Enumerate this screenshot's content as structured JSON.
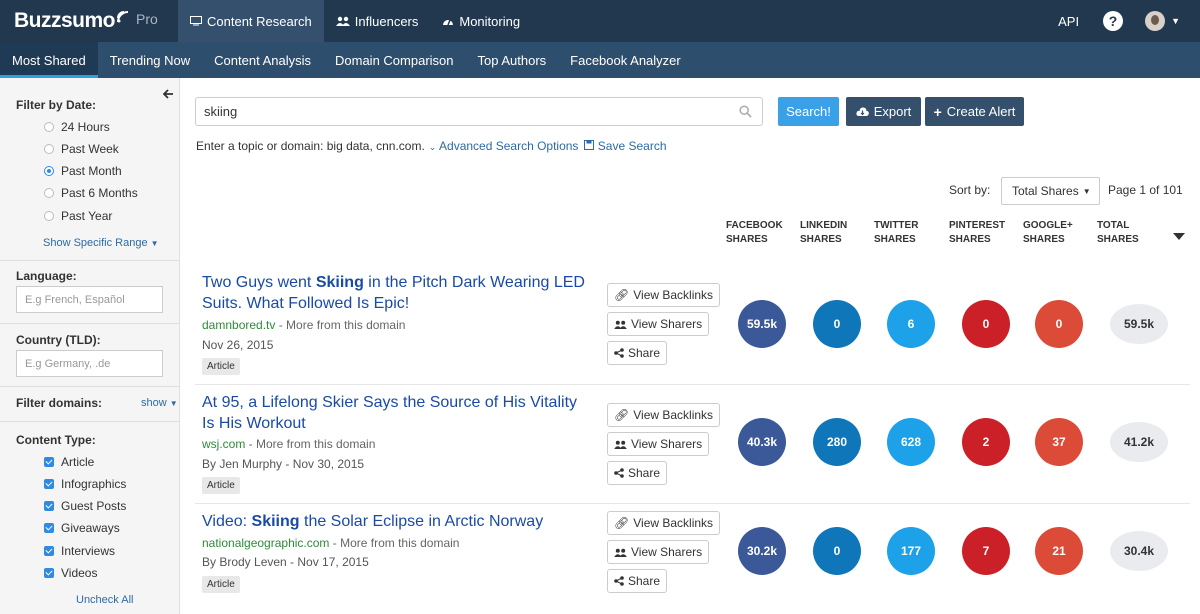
{
  "app": {
    "logo_text": "Buzzsumo",
    "logo_suffix": "Pro"
  },
  "topnav": [
    {
      "label": "Content Research",
      "icon": "monitor-icon",
      "active": true
    },
    {
      "label": "Influencers",
      "icon": "users-icon",
      "active": false
    },
    {
      "label": "Monitoring",
      "icon": "dashboard-icon",
      "active": false
    }
  ],
  "topright": {
    "api_label": "API",
    "help_symbol": "?"
  },
  "subnav": [
    {
      "label": "Most Shared",
      "active": true
    },
    {
      "label": "Trending Now",
      "active": false
    },
    {
      "label": "Content Analysis",
      "active": false
    },
    {
      "label": "Domain Comparison",
      "active": false
    },
    {
      "label": "Top Authors",
      "active": false
    },
    {
      "label": "Facebook Analyzer",
      "active": false
    }
  ],
  "sidebar": {
    "filter_by_date_label": "Filter by Date:",
    "date_options": [
      "24 Hours",
      "Past Week",
      "Past Month",
      "Past 6 Months",
      "Past Year"
    ],
    "date_selected": "Past Month",
    "specific_range_label": "Show Specific Range",
    "language_label": "Language:",
    "language_placeholder": "E.g French, Español",
    "country_label": "Country (TLD):",
    "country_placeholder": "E.g Germany, .de",
    "filter_domains_label": "Filter domains:",
    "filter_domains_toggle": "show",
    "content_type_label": "Content Type:",
    "content_types": [
      "Article",
      "Infographics",
      "Guest Posts",
      "Giveaways",
      "Interviews",
      "Videos"
    ],
    "uncheck_all_label": "Uncheck All"
  },
  "search": {
    "query": "skiing",
    "search_button": "Search!",
    "export_button": "Export",
    "create_alert_button": "Create Alert",
    "hint": "Enter a topic or domain: big data, cnn.com.",
    "advanced_link": "Advanced Search Options",
    "save_link": "Save Search"
  },
  "sort": {
    "label": "Sort by:",
    "selected": "Total Shares",
    "page_info": "Page 1 of 101"
  },
  "columns": [
    "FACEBOOK SHARES",
    "LINKEDIN SHARES",
    "TWITTER SHARES",
    "PINTEREST SHARES",
    "GOOGLE+ SHARES",
    "TOTAL SHARES"
  ],
  "colors": {
    "facebook": "#3b5998",
    "linkedin": "#0e76b9",
    "twitter": "#1da1e8",
    "pinterest": "#cb2027",
    "google": "#dc4a38",
    "accent": "#3aa0e8"
  },
  "actions": {
    "backlinks": "View Backlinks",
    "sharers": "View Sharers",
    "share": "Share"
  },
  "results": [
    {
      "title_pre": "Two Guys went ",
      "title_bold": "Skiing",
      "title_post": " in the Pitch Dark Wearing LED Suits. What Followed Is Epic!",
      "domain": "damnbored.tv",
      "more": " - More from this domain",
      "meta": "Nov 26, 2015",
      "tag": "Article",
      "facebook": "59.5k",
      "linkedin": "0",
      "twitter": "6",
      "pinterest": "0",
      "google": "0",
      "total": "59.5k"
    },
    {
      "title_pre": "At 95, a Lifelong Skier Says the Source of His Vitality Is His Workout",
      "title_bold": "",
      "title_post": "",
      "domain": "wsj.com",
      "more": " - More from this domain",
      "meta": "By Jen Murphy - Nov 30, 2015",
      "tag": "Article",
      "facebook": "40.3k",
      "linkedin": "280",
      "twitter": "628",
      "pinterest": "2",
      "google": "37",
      "total": "41.2k"
    },
    {
      "title_pre": "Video: ",
      "title_bold": "Skiing",
      "title_post": " the Solar Eclipse in Arctic Norway",
      "domain": "nationalgeographic.com",
      "more": " - More from this domain",
      "meta": "By Brody Leven - Nov 17, 2015",
      "tag": "Article",
      "facebook": "30.2k",
      "linkedin": "0",
      "twitter": "177",
      "pinterest": "7",
      "google": "21",
      "total": "30.4k"
    }
  ]
}
